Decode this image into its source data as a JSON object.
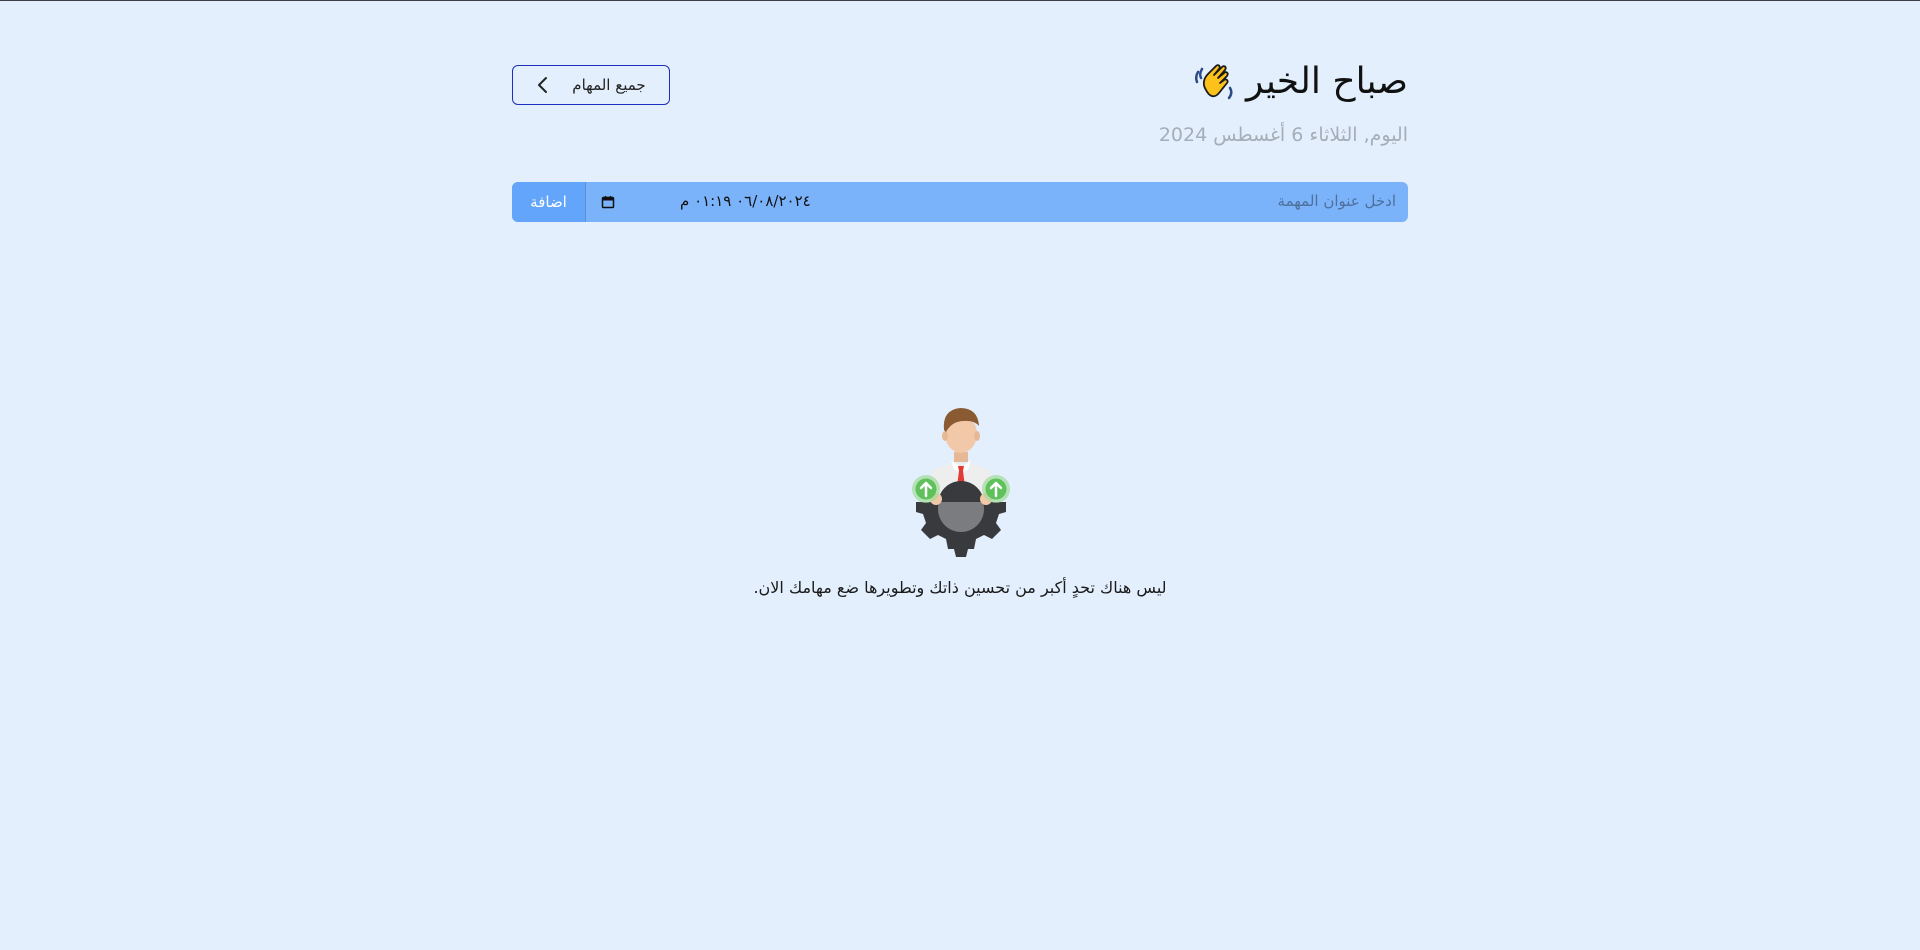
{
  "header": {
    "greeting": "صباح الخير",
    "greeting_icon": "waving-hand-icon",
    "date_line": "اليوم, الثلاثاء 6 أغسطس 2024",
    "all_tasks_label": "جميع المهام"
  },
  "task_form": {
    "title_placeholder": "ادخل عنوان المهمة",
    "datetime_value": "٠٦/٠٨/٢٠٢٤ ‏٠١:١٩ م",
    "add_label": "اضافة"
  },
  "empty_state": {
    "illustration": "person-gear-illustration",
    "message": "ليس هناك تحدٍ أكبر من تحسين ذاتك وتطويرها ضع مهامك الان."
  },
  "colors": {
    "background": "#e3effd",
    "form_bar": "#7bb3fb",
    "add_button": "#62a5fa",
    "outline_button": "#1c2fbf"
  }
}
